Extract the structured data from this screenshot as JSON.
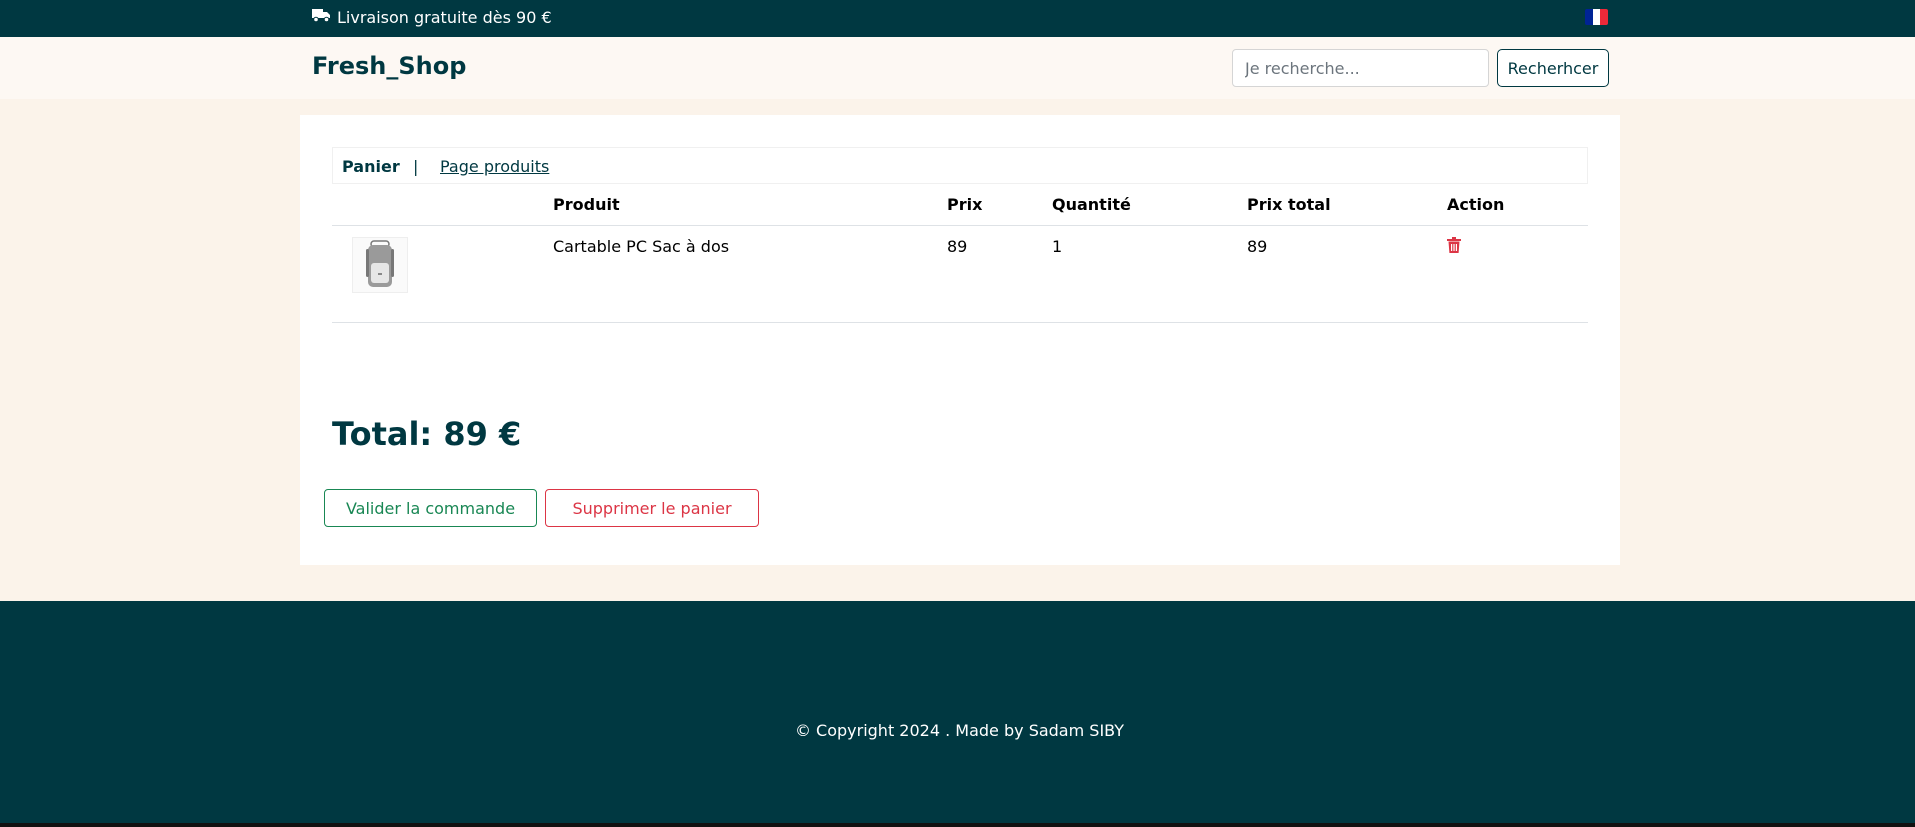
{
  "topbar": {
    "promo_text": "Livraison gratuite dès 90 €",
    "icon": "truck-icon",
    "flag_icon": "flag-fr-icon",
    "flag_colors": [
      "#002395",
      "#ffffff",
      "#ed2939"
    ]
  },
  "header": {
    "brand": "Fresh_Shop",
    "search_placeholder": "Je recherche...",
    "search_button": "Recherhcer"
  },
  "tabs": {
    "active": "Panier",
    "separator": "|",
    "link": "Page produits"
  },
  "cart_table": {
    "headers": [
      "",
      "Produit",
      "Prix",
      "Quantité",
      "Prix total",
      "Action"
    ],
    "rows": [
      {
        "image": "backpack-image",
        "product": "Cartable PC Sac à dos",
        "price": "89",
        "quantity": "1",
        "total": "89",
        "action_icon": "trash-icon"
      }
    ]
  },
  "summary": {
    "total_text": "Total: 89 €"
  },
  "buttons": {
    "validate": "Valider la commande",
    "clear": "Supprimer le panier"
  },
  "footer": {
    "copyright": "© Copyright 2024 . Made by Sadam SIBY"
  },
  "colors": {
    "primary": "#003841",
    "background": "#fbf3ea",
    "success": "#198754",
    "danger": "#dc3545"
  }
}
